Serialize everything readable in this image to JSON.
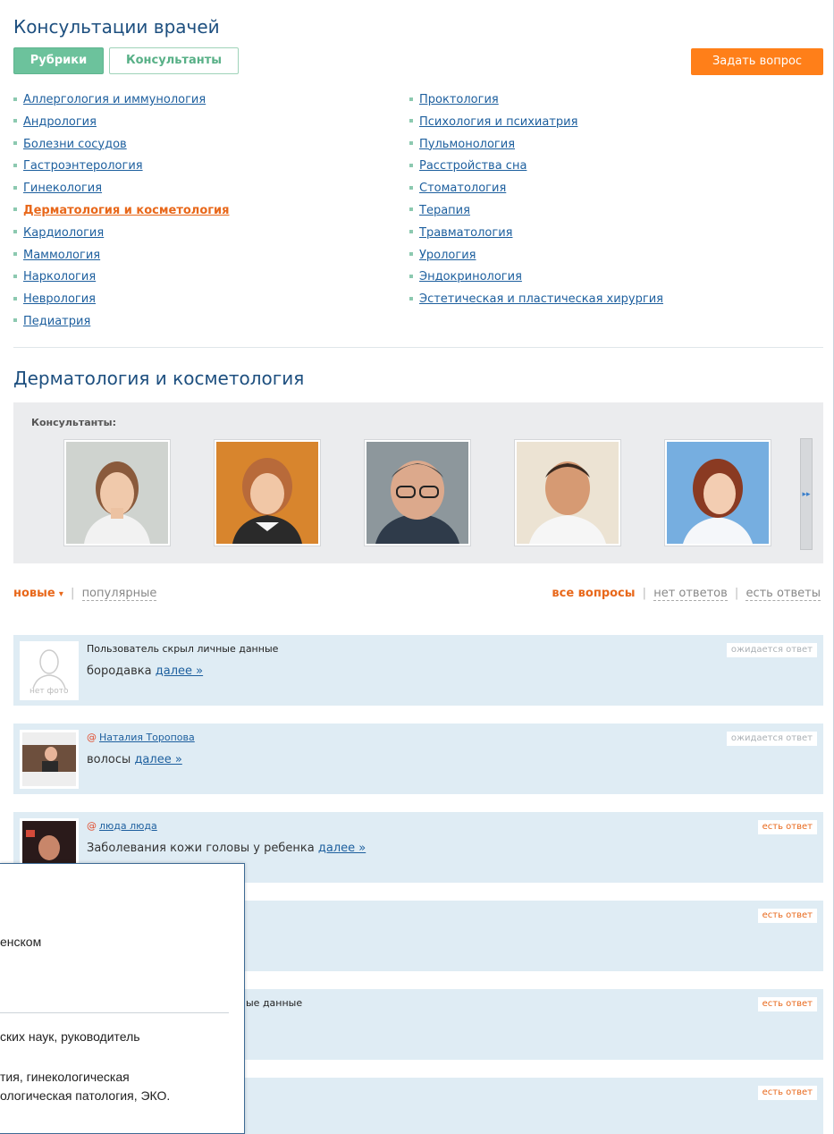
{
  "header": {
    "title": "Консультации врачей",
    "tab_rubrics": "Рубрики",
    "tab_consultants": "Консультанты",
    "ask_button": "Задать вопрос"
  },
  "categories_left": [
    "Аллергология и иммунология",
    "Андрология",
    "Болезни сосудов",
    "Гастроэнтерология",
    "Гинекология",
    "Дерматология и косметология",
    "Кардиология",
    "Маммология",
    "Наркология",
    "Неврология",
    "Педиатрия"
  ],
  "categories_right": [
    "Проктология",
    "Психология и психиатрия",
    "Пульмонология",
    "Расстройства сна",
    "Стоматология",
    "Терапия",
    "Травматология",
    "Урология",
    "Эндокринология",
    "Эстетическая и пластическая хирургия"
  ],
  "active_category": "Дерматология и косметология",
  "section": {
    "title": "Дерматология и косметология",
    "consultants_label": "Консультанты:",
    "next_arrow": "▸▸"
  },
  "sort": {
    "new": "новые",
    "caret": "▾",
    "popular": "популярные",
    "sep": "|",
    "all": "все вопросы",
    "no_answers": "нет ответов",
    "has_answers": "есть ответы"
  },
  "questions": [
    {
      "author": "Пользователь скрыл личные данные",
      "author_link": "",
      "text": "бородавка",
      "more": "далее »",
      "status": "ожидается ответ",
      "no_photo": "нет фото"
    },
    {
      "author": "",
      "author_link": "Наталия Торопова",
      "at": "@",
      "text": "волосы",
      "more": "далее »",
      "status": "ожидается ответ"
    },
    {
      "author": "",
      "author_link": "люда люда",
      "at": "@",
      "text": "Заболевания кожи головы у ребенка",
      "more": "далее »",
      "status": "есть ответ"
    },
    {
      "status": "есть ответ"
    },
    {
      "author_partial": "ые данные",
      "status": "есть ответ"
    },
    {
      "status": "есть ответ"
    }
  ],
  "popup": {
    "line1": "енском",
    "line2": "ских наук, руководитель",
    "line3": "тия, гинекологическая",
    "line4": "ологическая патология, ЭКО."
  },
  "colors": {
    "accent_orange": "#ff7f19",
    "tab_green": "#6cc29c",
    "link_blue": "#1d5f9e",
    "question_bg": "#dfecf4"
  }
}
